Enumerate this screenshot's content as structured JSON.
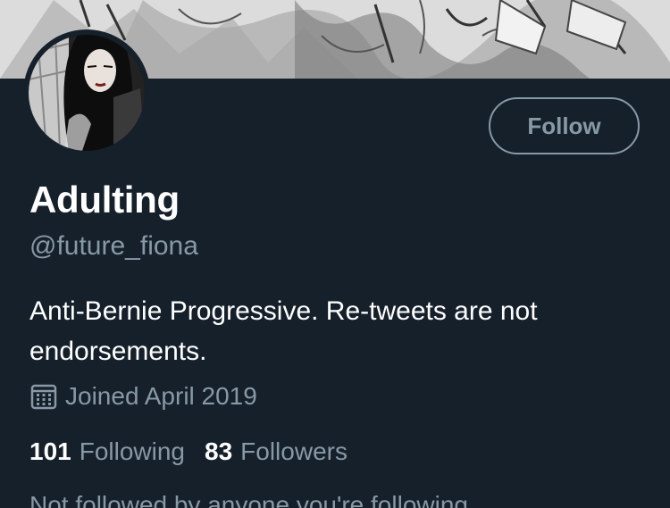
{
  "profile": {
    "display_name": "Adulting",
    "handle": "@future_fiona",
    "bio": "Anti-Bernie Progressive. Re-tweets are not endorsements.",
    "joined": "Joined April 2019",
    "follow_label": "Follow",
    "following_count": "101",
    "following_label": "Following",
    "followers_count": "83",
    "followers_label": "Followers",
    "not_followed_text": "Not followed by anyone you're following"
  },
  "icons": {
    "calendar": "calendar-icon"
  },
  "colors": {
    "background": "#15202b",
    "primary_text": "#ffffff",
    "secondary_text": "#8899a6",
    "button_border": "#8899a6"
  }
}
